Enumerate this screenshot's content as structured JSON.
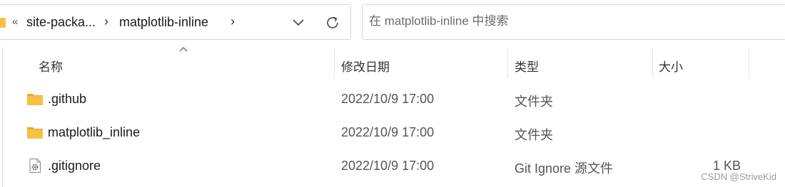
{
  "address_bar": {
    "overflow_glyph": "«",
    "breadcrumbs": [
      "site-packa...",
      "matplotlib-inline"
    ],
    "separator": "›"
  },
  "search": {
    "placeholder": "在 matplotlib-inline 中搜索"
  },
  "columns": {
    "name": "名称",
    "date": "修改日期",
    "type": "类型",
    "size": "大小"
  },
  "files": [
    {
      "name": ".github",
      "date": "2022/10/9 17:00",
      "type": "文件夹",
      "size": "",
      "icon": "folder-icon"
    },
    {
      "name": "matplotlib_inline",
      "date": "2022/10/9 17:00",
      "type": "文件夹",
      "size": "",
      "icon": "folder-icon"
    },
    {
      "name": ".gitignore",
      "date": "2022/10/9 17:00",
      "type": "Git Ignore 源文件",
      "size": "1 KB",
      "icon": "settings-file-icon"
    }
  ],
  "watermark": "CSDN @StriveKid",
  "colors": {
    "folder": "#f6c244",
    "folder_dark": "#e0a82e",
    "border": "#d6d6d6"
  }
}
